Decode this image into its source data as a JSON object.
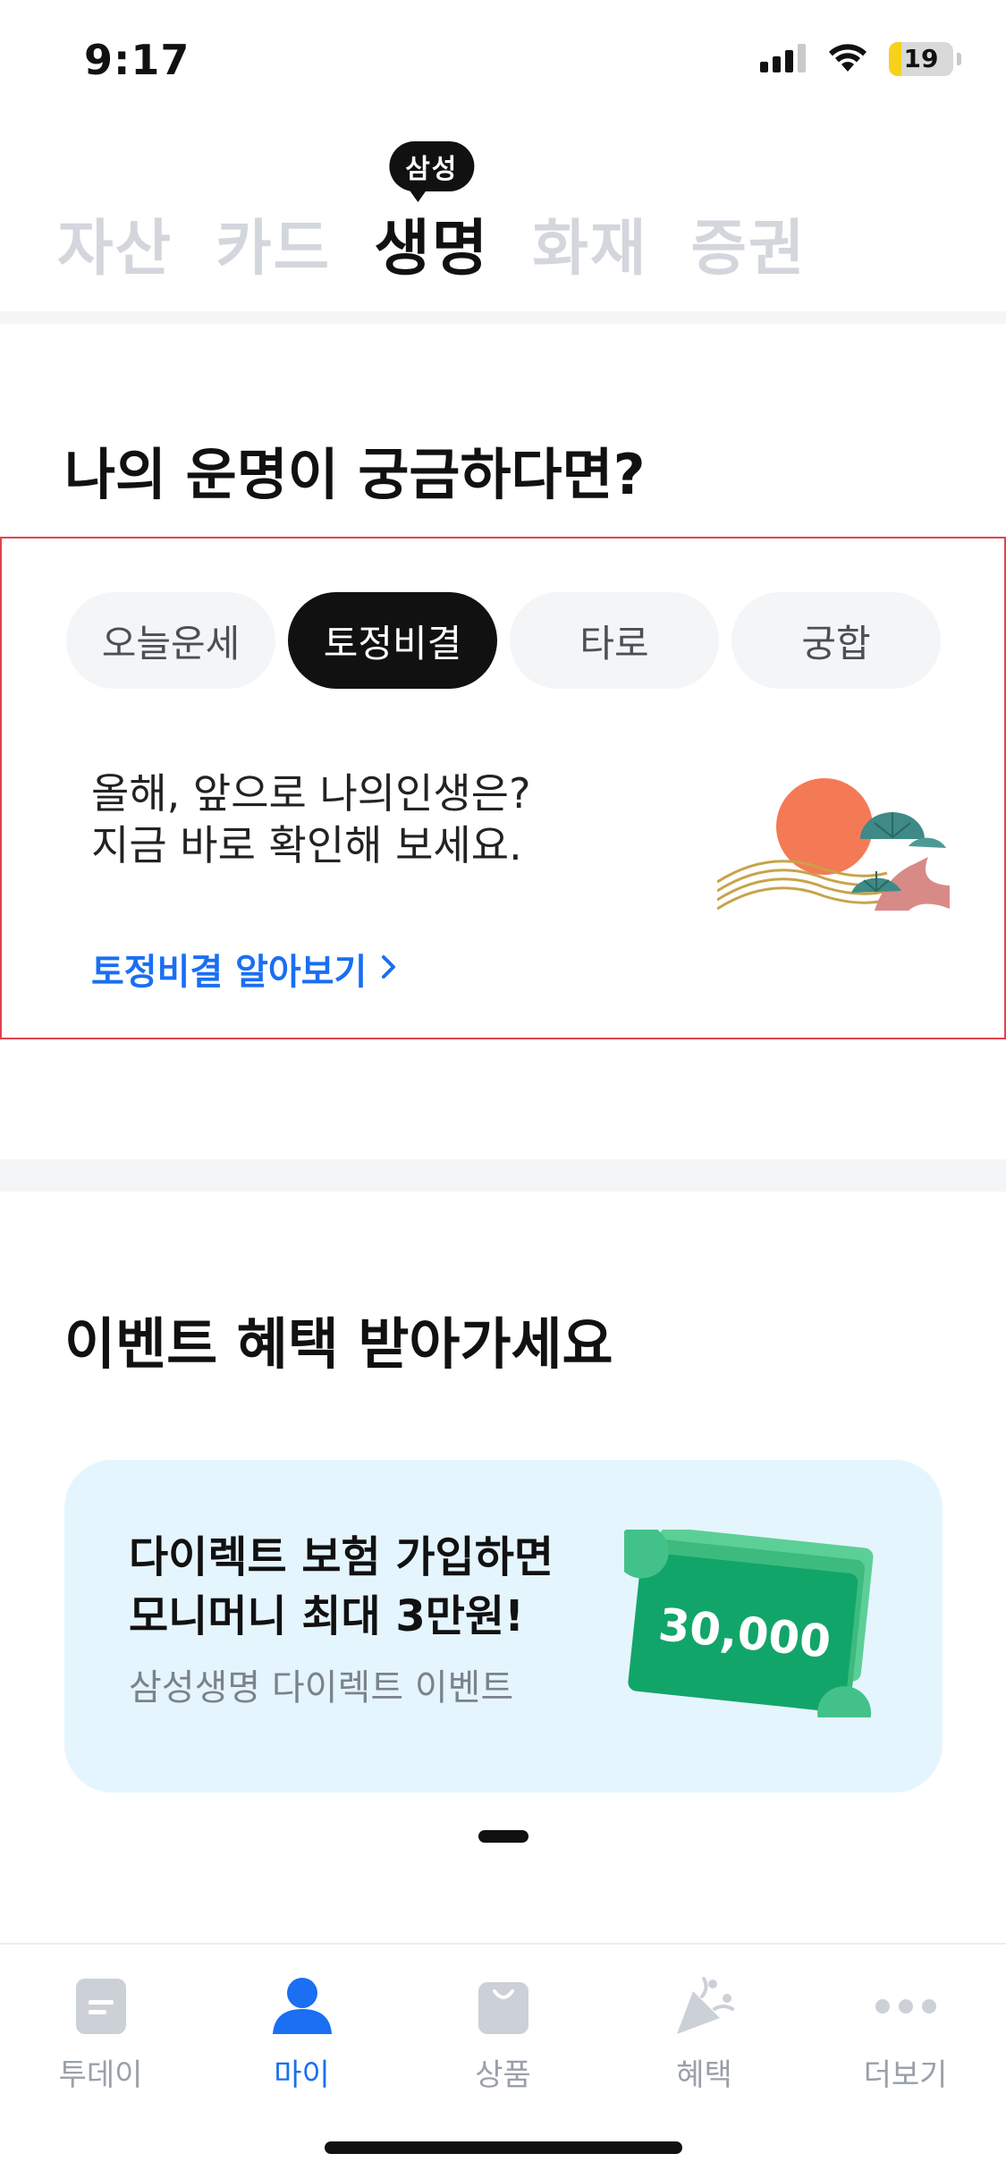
{
  "status_bar": {
    "time": "9:17",
    "battery": "19",
    "battery_level": 0.19,
    "icons": [
      "signal-icon",
      "wifi-icon",
      "battery-icon"
    ]
  },
  "top_tabs": {
    "items": [
      "자산",
      "카드",
      "생명",
      "화재",
      "증권"
    ],
    "active_index": 2,
    "badge": "삼성"
  },
  "fortune": {
    "title": "나의 운명이 궁금하다면?",
    "chips": [
      "오늘운세",
      "토정비결",
      "타로",
      "궁합"
    ],
    "active_chip": 1,
    "line1": "올해, 앞으로 나의인생은?",
    "line2": "지금 바로 확인해 보세요.",
    "link": "토정비결 알아보기"
  },
  "event": {
    "section_title": "이벤트 혜택 받아가세요",
    "title_line1": "다이렉트 보험 가입하면",
    "title_line2": "모니머니 최대 3만원!",
    "subtitle": "삼성생명 다이렉트 이벤트",
    "bill_amount": "30,000"
  },
  "bottom_nav": {
    "items": [
      {
        "label": "투데이",
        "icon": "today-icon"
      },
      {
        "label": "마이",
        "icon": "person-icon"
      },
      {
        "label": "상품",
        "icon": "shopping-bag-icon"
      },
      {
        "label": "혜택",
        "icon": "party-popper-icon"
      },
      {
        "label": "더보기",
        "icon": "more-dots-icon"
      }
    ],
    "active_index": 1
  },
  "colors": {
    "accent": "#1a6ff2",
    "inactive_tab": "#d3d6dc",
    "event_bg": "#e5f5fd",
    "highlight_border": "#e2424d"
  }
}
